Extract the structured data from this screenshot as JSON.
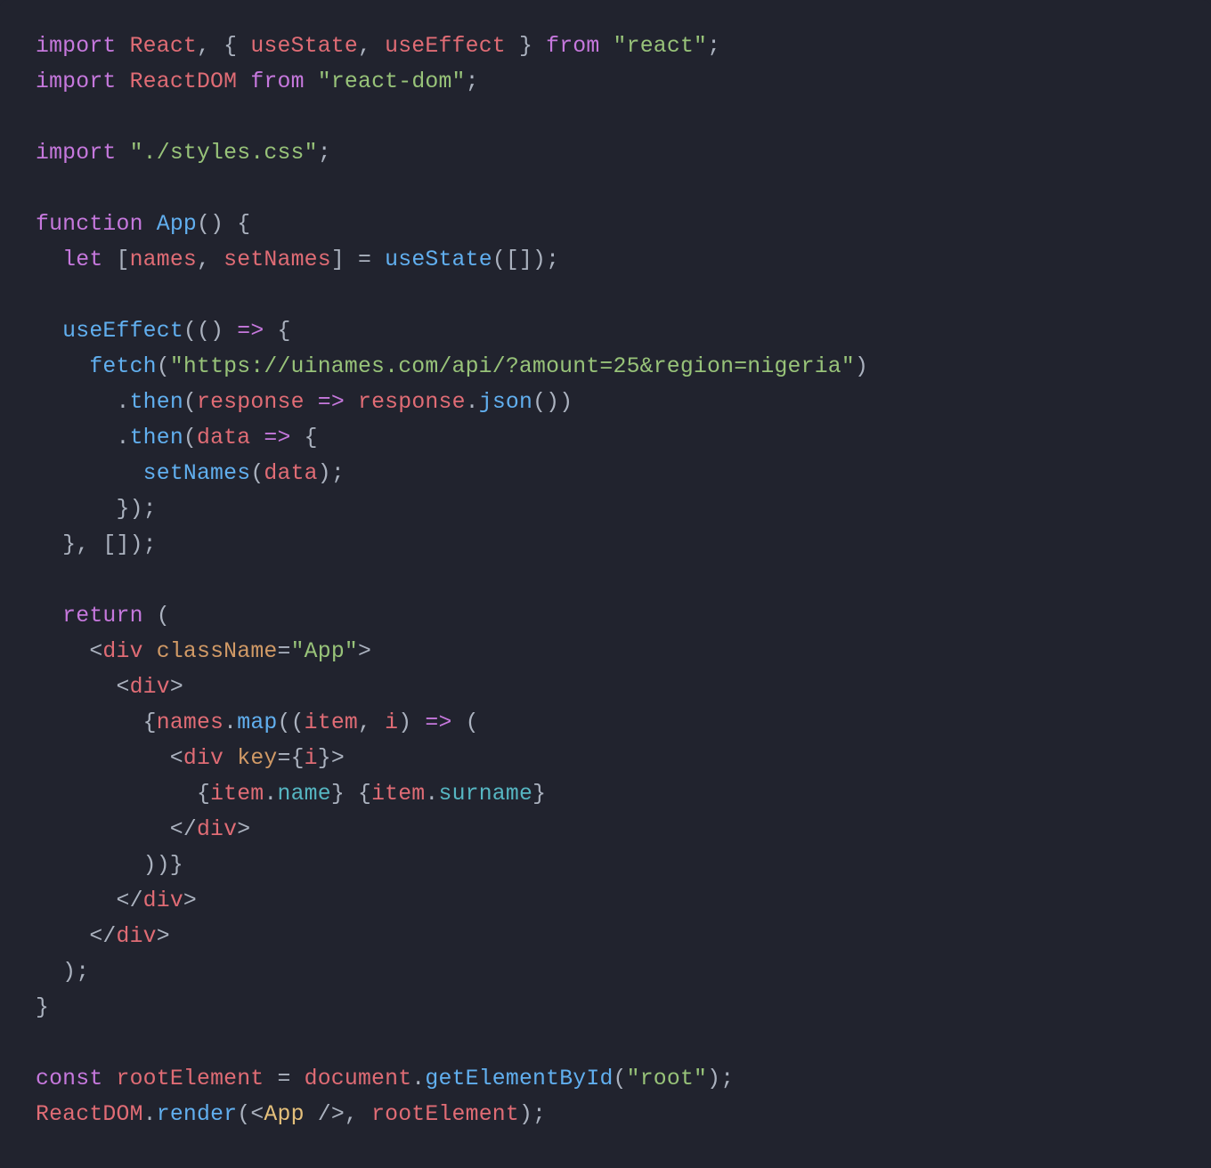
{
  "code": {
    "lines": [
      [
        {
          "c": "kw",
          "t": "import"
        },
        {
          "c": "g",
          "t": " "
        },
        {
          "c": "id",
          "t": "React"
        },
        {
          "c": "g",
          "t": ", { "
        },
        {
          "c": "id",
          "t": "useState"
        },
        {
          "c": "g",
          "t": ", "
        },
        {
          "c": "id",
          "t": "useEffect"
        },
        {
          "c": "g",
          "t": " } "
        },
        {
          "c": "kw",
          "t": "from"
        },
        {
          "c": "g",
          "t": " "
        },
        {
          "c": "str",
          "t": "\"react\""
        },
        {
          "c": "g",
          "t": ";"
        }
      ],
      [
        {
          "c": "kw",
          "t": "import"
        },
        {
          "c": "g",
          "t": " "
        },
        {
          "c": "id",
          "t": "ReactDOM"
        },
        {
          "c": "g",
          "t": " "
        },
        {
          "c": "kw",
          "t": "from"
        },
        {
          "c": "g",
          "t": " "
        },
        {
          "c": "str",
          "t": "\"react-dom\""
        },
        {
          "c": "g",
          "t": ";"
        }
      ],
      [],
      [
        {
          "c": "kw",
          "t": "import"
        },
        {
          "c": "g",
          "t": " "
        },
        {
          "c": "str",
          "t": "\"./styles.css\""
        },
        {
          "c": "g",
          "t": ";"
        }
      ],
      [],
      [
        {
          "c": "kw",
          "t": "function"
        },
        {
          "c": "g",
          "t": " "
        },
        {
          "c": "fnName",
          "t": "App"
        },
        {
          "c": "g",
          "t": "() {"
        }
      ],
      [
        {
          "c": "g",
          "t": "  "
        },
        {
          "c": "kw",
          "t": "let"
        },
        {
          "c": "g",
          "t": " ["
        },
        {
          "c": "id",
          "t": "names"
        },
        {
          "c": "g",
          "t": ", "
        },
        {
          "c": "id",
          "t": "setNames"
        },
        {
          "c": "g",
          "t": "] = "
        },
        {
          "c": "fnName",
          "t": "useState"
        },
        {
          "c": "g",
          "t": "([]);"
        }
      ],
      [],
      [
        {
          "c": "g",
          "t": "  "
        },
        {
          "c": "fnName",
          "t": "useEffect"
        },
        {
          "c": "g",
          "t": "(() "
        },
        {
          "c": "arrow",
          "t": "=>"
        },
        {
          "c": "g",
          "t": " {"
        }
      ],
      [
        {
          "c": "g",
          "t": "    "
        },
        {
          "c": "fnName",
          "t": "fetch"
        },
        {
          "c": "g",
          "t": "("
        },
        {
          "c": "str",
          "t": "\"https://uinames.com/api/?amount=25&region=nigeria\""
        },
        {
          "c": "g",
          "t": ")"
        }
      ],
      [
        {
          "c": "g",
          "t": "      ."
        },
        {
          "c": "fnName",
          "t": "then"
        },
        {
          "c": "g",
          "t": "("
        },
        {
          "c": "id",
          "t": "response"
        },
        {
          "c": "g",
          "t": " "
        },
        {
          "c": "arrow",
          "t": "=>"
        },
        {
          "c": "g",
          "t": " "
        },
        {
          "c": "id",
          "t": "response"
        },
        {
          "c": "g",
          "t": "."
        },
        {
          "c": "fnName",
          "t": "json"
        },
        {
          "c": "g",
          "t": "())"
        }
      ],
      [
        {
          "c": "g",
          "t": "      ."
        },
        {
          "c": "fnName",
          "t": "then"
        },
        {
          "c": "g",
          "t": "("
        },
        {
          "c": "id",
          "t": "data"
        },
        {
          "c": "g",
          "t": " "
        },
        {
          "c": "arrow",
          "t": "=>"
        },
        {
          "c": "g",
          "t": " {"
        }
      ],
      [
        {
          "c": "g",
          "t": "        "
        },
        {
          "c": "fnName",
          "t": "setNames"
        },
        {
          "c": "g",
          "t": "("
        },
        {
          "c": "id",
          "t": "data"
        },
        {
          "c": "g",
          "t": ");"
        }
      ],
      [
        {
          "c": "g",
          "t": "      });"
        }
      ],
      [
        {
          "c": "g",
          "t": "  }, []);"
        }
      ],
      [],
      [
        {
          "c": "g",
          "t": "  "
        },
        {
          "c": "kw",
          "t": "return"
        },
        {
          "c": "g",
          "t": " ("
        }
      ],
      [
        {
          "c": "g",
          "t": "    <"
        },
        {
          "c": "tag",
          "t": "div"
        },
        {
          "c": "g",
          "t": " "
        },
        {
          "c": "attr",
          "t": "className"
        },
        {
          "c": "g",
          "t": "="
        },
        {
          "c": "str",
          "t": "\"App\""
        },
        {
          "c": "g",
          "t": ">"
        }
      ],
      [
        {
          "c": "g",
          "t": "      <"
        },
        {
          "c": "tag",
          "t": "div"
        },
        {
          "c": "g",
          "t": ">"
        }
      ],
      [
        {
          "c": "g",
          "t": "        {"
        },
        {
          "c": "id",
          "t": "names"
        },
        {
          "c": "g",
          "t": "."
        },
        {
          "c": "fnName",
          "t": "map"
        },
        {
          "c": "g",
          "t": "(("
        },
        {
          "c": "id",
          "t": "item"
        },
        {
          "c": "g",
          "t": ", "
        },
        {
          "c": "id",
          "t": "i"
        },
        {
          "c": "g",
          "t": ") "
        },
        {
          "c": "arrow",
          "t": "=>"
        },
        {
          "c": "g",
          "t": " ("
        }
      ],
      [
        {
          "c": "g",
          "t": "          <"
        },
        {
          "c": "tag",
          "t": "div"
        },
        {
          "c": "g",
          "t": " "
        },
        {
          "c": "attr",
          "t": "key"
        },
        {
          "c": "g",
          "t": "={"
        },
        {
          "c": "id",
          "t": "i"
        },
        {
          "c": "g",
          "t": "}>"
        }
      ],
      [
        {
          "c": "g",
          "t": "            {"
        },
        {
          "c": "id",
          "t": "item"
        },
        {
          "c": "g",
          "t": "."
        },
        {
          "c": "prop",
          "t": "name"
        },
        {
          "c": "g",
          "t": "} {"
        },
        {
          "c": "id",
          "t": "item"
        },
        {
          "c": "g",
          "t": "."
        },
        {
          "c": "prop",
          "t": "surname"
        },
        {
          "c": "g",
          "t": "}"
        }
      ],
      [
        {
          "c": "g",
          "t": "          </"
        },
        {
          "c": "tag",
          "t": "div"
        },
        {
          "c": "g",
          "t": ">"
        }
      ],
      [
        {
          "c": "g",
          "t": "        ))}"
        }
      ],
      [
        {
          "c": "g",
          "t": "      </"
        },
        {
          "c": "tag",
          "t": "div"
        },
        {
          "c": "g",
          "t": ">"
        }
      ],
      [
        {
          "c": "g",
          "t": "    </"
        },
        {
          "c": "tag",
          "t": "div"
        },
        {
          "c": "g",
          "t": ">"
        }
      ],
      [
        {
          "c": "g",
          "t": "  );"
        }
      ],
      [
        {
          "c": "g",
          "t": "}"
        }
      ],
      [],
      [
        {
          "c": "kw",
          "t": "const"
        },
        {
          "c": "g",
          "t": " "
        },
        {
          "c": "id",
          "t": "rootElement"
        },
        {
          "c": "g",
          "t": " = "
        },
        {
          "c": "id",
          "t": "document"
        },
        {
          "c": "g",
          "t": "."
        },
        {
          "c": "fnName",
          "t": "getElementById"
        },
        {
          "c": "g",
          "t": "("
        },
        {
          "c": "str",
          "t": "\"root\""
        },
        {
          "c": "g",
          "t": ");"
        }
      ],
      [
        {
          "c": "id",
          "t": "ReactDOM"
        },
        {
          "c": "g",
          "t": "."
        },
        {
          "c": "fnName",
          "t": "render"
        },
        {
          "c": "g",
          "t": "(<"
        },
        {
          "c": "def",
          "t": "App"
        },
        {
          "c": "g",
          "t": " />, "
        },
        {
          "c": "id",
          "t": "rootElement"
        },
        {
          "c": "g",
          "t": ");"
        }
      ]
    ]
  }
}
